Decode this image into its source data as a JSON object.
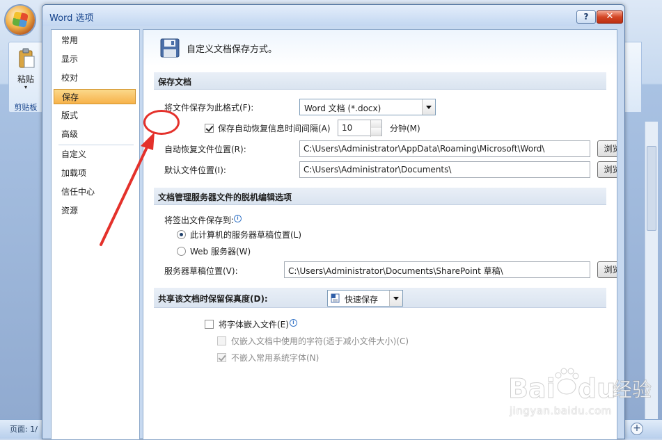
{
  "background": {
    "ribbon": {
      "paste_label": "粘贴",
      "clipboard_label": "剪贴板"
    },
    "status_bar": {
      "page_text": "页面: 1/"
    },
    "zoom_in": "+"
  },
  "dialog": {
    "title": "Word 选项",
    "help_label": "?",
    "close_label": "✕"
  },
  "nav": {
    "items": [
      "常用",
      "显示",
      "校对",
      "保存",
      "版式",
      "高级",
      "自定义",
      "加载项",
      "信任中心",
      "资源"
    ],
    "selected": "保存"
  },
  "content": {
    "heading": "自定义文档保存方式。",
    "save_section": {
      "title": "保存文档",
      "format_label": "将文件保存为此格式(F):",
      "format_value": "Word 文档 (*.docx)",
      "autorecover_checked": true,
      "autorecover_label": "保存自动恢复信息时间间隔(A)",
      "autorecover_minutes": "10",
      "minutes_label": "分钟(M)",
      "autorecover_location_label": "自动恢复文件位置(R):",
      "autorecover_location_value": "C:\\Users\\Administrator\\AppData\\Roaming\\Microsoft\\Word\\",
      "default_location_label": "默认文件位置(I):",
      "default_location_value": "C:\\Users\\Administrator\\Documents\\",
      "browse_label": "浏览(B)..."
    },
    "offline_section": {
      "title": "文档管理服务器文件的脱机编辑选项",
      "checkout_label": "将签出文件保存到:",
      "option_local": "此计算机的服务器草稿位置(L)",
      "option_web": "Web 服务器(W)",
      "selected_option": "此计算机的服务器草稿位置(L)",
      "drafts_label": "服务器草稿位置(V):",
      "drafts_value": "C:\\Users\\Administrator\\Documents\\SharePoint 草稿\\",
      "browse_label": "浏览(B)..."
    },
    "fidelity_section": {
      "title": "共享该文档时保留保真度(D):",
      "document_value": "快速保存",
      "embed_fonts_label": "将字体嵌入文件(E)",
      "embed_fonts_checked": false,
      "embed_used_chars_label": "仅嵌入文档中使用的字符(适于减小文件大小)(C)",
      "embed_used_chars_checked": false,
      "no_system_fonts_label": "不嵌入常用系统字体(N)",
      "no_system_fonts_checked": true
    }
  },
  "watermark": {
    "brand": "Baidu经验",
    "url": "jingyan.baidu.com"
  },
  "colors": {
    "annotation_red": "#e4312b",
    "nav_selected": "#f7b24a",
    "title_text": "#15428b"
  }
}
